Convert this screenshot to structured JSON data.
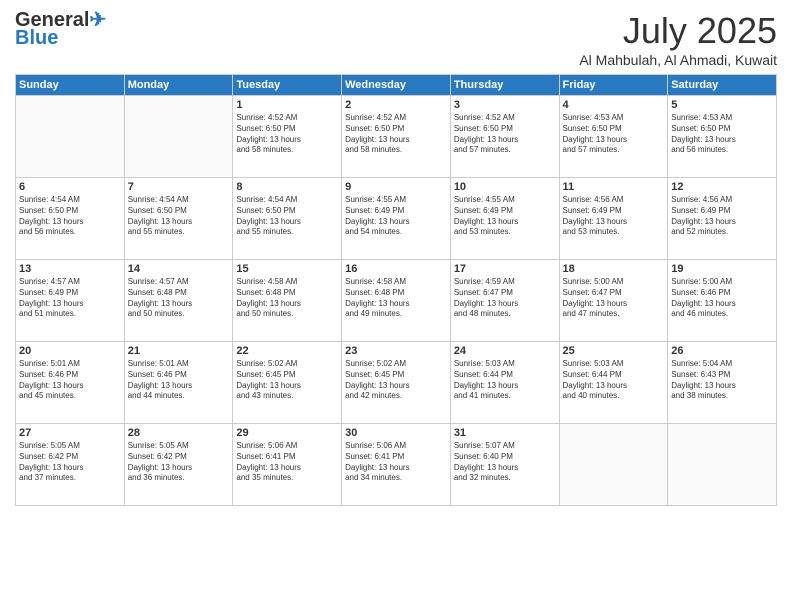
{
  "logo": {
    "line1": "General",
    "line2": "Blue"
  },
  "title": "July 2025",
  "subtitle": "Al Mahbulah, Al Ahmadi, Kuwait",
  "days_of_week": [
    "Sunday",
    "Monday",
    "Tuesday",
    "Wednesday",
    "Thursday",
    "Friday",
    "Saturday"
  ],
  "weeks": [
    [
      {
        "day": "",
        "info": ""
      },
      {
        "day": "",
        "info": ""
      },
      {
        "day": "1",
        "info": "Sunrise: 4:52 AM\nSunset: 6:50 PM\nDaylight: 13 hours\nand 58 minutes."
      },
      {
        "day": "2",
        "info": "Sunrise: 4:52 AM\nSunset: 6:50 PM\nDaylight: 13 hours\nand 58 minutes."
      },
      {
        "day": "3",
        "info": "Sunrise: 4:52 AM\nSunset: 6:50 PM\nDaylight: 13 hours\nand 57 minutes."
      },
      {
        "day": "4",
        "info": "Sunrise: 4:53 AM\nSunset: 6:50 PM\nDaylight: 13 hours\nand 57 minutes."
      },
      {
        "day": "5",
        "info": "Sunrise: 4:53 AM\nSunset: 6:50 PM\nDaylight: 13 hours\nand 56 minutes."
      }
    ],
    [
      {
        "day": "6",
        "info": "Sunrise: 4:54 AM\nSunset: 6:50 PM\nDaylight: 13 hours\nand 56 minutes."
      },
      {
        "day": "7",
        "info": "Sunrise: 4:54 AM\nSunset: 6:50 PM\nDaylight: 13 hours\nand 55 minutes."
      },
      {
        "day": "8",
        "info": "Sunrise: 4:54 AM\nSunset: 6:50 PM\nDaylight: 13 hours\nand 55 minutes."
      },
      {
        "day": "9",
        "info": "Sunrise: 4:55 AM\nSunset: 6:49 PM\nDaylight: 13 hours\nand 54 minutes."
      },
      {
        "day": "10",
        "info": "Sunrise: 4:55 AM\nSunset: 6:49 PM\nDaylight: 13 hours\nand 53 minutes."
      },
      {
        "day": "11",
        "info": "Sunrise: 4:56 AM\nSunset: 6:49 PM\nDaylight: 13 hours\nand 53 minutes."
      },
      {
        "day": "12",
        "info": "Sunrise: 4:56 AM\nSunset: 6:49 PM\nDaylight: 13 hours\nand 52 minutes."
      }
    ],
    [
      {
        "day": "13",
        "info": "Sunrise: 4:57 AM\nSunset: 6:49 PM\nDaylight: 13 hours\nand 51 minutes."
      },
      {
        "day": "14",
        "info": "Sunrise: 4:57 AM\nSunset: 6:48 PM\nDaylight: 13 hours\nand 50 minutes."
      },
      {
        "day": "15",
        "info": "Sunrise: 4:58 AM\nSunset: 6:48 PM\nDaylight: 13 hours\nand 50 minutes."
      },
      {
        "day": "16",
        "info": "Sunrise: 4:58 AM\nSunset: 6:48 PM\nDaylight: 13 hours\nand 49 minutes."
      },
      {
        "day": "17",
        "info": "Sunrise: 4:59 AM\nSunset: 6:47 PM\nDaylight: 13 hours\nand 48 minutes."
      },
      {
        "day": "18",
        "info": "Sunrise: 5:00 AM\nSunset: 6:47 PM\nDaylight: 13 hours\nand 47 minutes."
      },
      {
        "day": "19",
        "info": "Sunrise: 5:00 AM\nSunset: 6:46 PM\nDaylight: 13 hours\nand 46 minutes."
      }
    ],
    [
      {
        "day": "20",
        "info": "Sunrise: 5:01 AM\nSunset: 6:46 PM\nDaylight: 13 hours\nand 45 minutes."
      },
      {
        "day": "21",
        "info": "Sunrise: 5:01 AM\nSunset: 6:46 PM\nDaylight: 13 hours\nand 44 minutes."
      },
      {
        "day": "22",
        "info": "Sunrise: 5:02 AM\nSunset: 6:45 PM\nDaylight: 13 hours\nand 43 minutes."
      },
      {
        "day": "23",
        "info": "Sunrise: 5:02 AM\nSunset: 6:45 PM\nDaylight: 13 hours\nand 42 minutes."
      },
      {
        "day": "24",
        "info": "Sunrise: 5:03 AM\nSunset: 6:44 PM\nDaylight: 13 hours\nand 41 minutes."
      },
      {
        "day": "25",
        "info": "Sunrise: 5:03 AM\nSunset: 6:44 PM\nDaylight: 13 hours\nand 40 minutes."
      },
      {
        "day": "26",
        "info": "Sunrise: 5:04 AM\nSunset: 6:43 PM\nDaylight: 13 hours\nand 38 minutes."
      }
    ],
    [
      {
        "day": "27",
        "info": "Sunrise: 5:05 AM\nSunset: 6:42 PM\nDaylight: 13 hours\nand 37 minutes."
      },
      {
        "day": "28",
        "info": "Sunrise: 5:05 AM\nSunset: 6:42 PM\nDaylight: 13 hours\nand 36 minutes."
      },
      {
        "day": "29",
        "info": "Sunrise: 5:06 AM\nSunset: 6:41 PM\nDaylight: 13 hours\nand 35 minutes."
      },
      {
        "day": "30",
        "info": "Sunrise: 5:06 AM\nSunset: 6:41 PM\nDaylight: 13 hours\nand 34 minutes."
      },
      {
        "day": "31",
        "info": "Sunrise: 5:07 AM\nSunset: 6:40 PM\nDaylight: 13 hours\nand 32 minutes."
      },
      {
        "day": "",
        "info": ""
      },
      {
        "day": "",
        "info": ""
      }
    ]
  ]
}
